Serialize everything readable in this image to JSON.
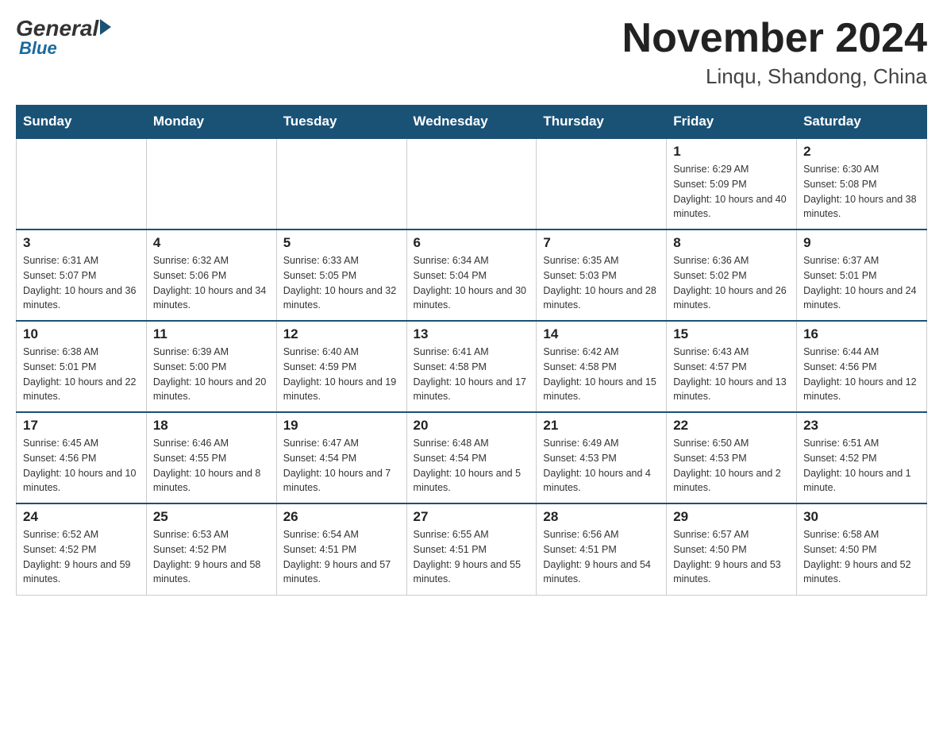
{
  "logo": {
    "general": "General",
    "blue": "Blue"
  },
  "title": {
    "month": "November 2024",
    "location": "Linqu, Shandong, China"
  },
  "weekdays": [
    "Sunday",
    "Monday",
    "Tuesday",
    "Wednesday",
    "Thursday",
    "Friday",
    "Saturday"
  ],
  "weeks": [
    [
      {
        "day": "",
        "empty": true
      },
      {
        "day": "",
        "empty": true
      },
      {
        "day": "",
        "empty": true
      },
      {
        "day": "",
        "empty": true
      },
      {
        "day": "",
        "empty": true
      },
      {
        "day": "1",
        "sunrise": "Sunrise: 6:29 AM",
        "sunset": "Sunset: 5:09 PM",
        "daylight": "Daylight: 10 hours and 40 minutes."
      },
      {
        "day": "2",
        "sunrise": "Sunrise: 6:30 AM",
        "sunset": "Sunset: 5:08 PM",
        "daylight": "Daylight: 10 hours and 38 minutes."
      }
    ],
    [
      {
        "day": "3",
        "sunrise": "Sunrise: 6:31 AM",
        "sunset": "Sunset: 5:07 PM",
        "daylight": "Daylight: 10 hours and 36 minutes."
      },
      {
        "day": "4",
        "sunrise": "Sunrise: 6:32 AM",
        "sunset": "Sunset: 5:06 PM",
        "daylight": "Daylight: 10 hours and 34 minutes."
      },
      {
        "day": "5",
        "sunrise": "Sunrise: 6:33 AM",
        "sunset": "Sunset: 5:05 PM",
        "daylight": "Daylight: 10 hours and 32 minutes."
      },
      {
        "day": "6",
        "sunrise": "Sunrise: 6:34 AM",
        "sunset": "Sunset: 5:04 PM",
        "daylight": "Daylight: 10 hours and 30 minutes."
      },
      {
        "day": "7",
        "sunrise": "Sunrise: 6:35 AM",
        "sunset": "Sunset: 5:03 PM",
        "daylight": "Daylight: 10 hours and 28 minutes."
      },
      {
        "day": "8",
        "sunrise": "Sunrise: 6:36 AM",
        "sunset": "Sunset: 5:02 PM",
        "daylight": "Daylight: 10 hours and 26 minutes."
      },
      {
        "day": "9",
        "sunrise": "Sunrise: 6:37 AM",
        "sunset": "Sunset: 5:01 PM",
        "daylight": "Daylight: 10 hours and 24 minutes."
      }
    ],
    [
      {
        "day": "10",
        "sunrise": "Sunrise: 6:38 AM",
        "sunset": "Sunset: 5:01 PM",
        "daylight": "Daylight: 10 hours and 22 minutes."
      },
      {
        "day": "11",
        "sunrise": "Sunrise: 6:39 AM",
        "sunset": "Sunset: 5:00 PM",
        "daylight": "Daylight: 10 hours and 20 minutes."
      },
      {
        "day": "12",
        "sunrise": "Sunrise: 6:40 AM",
        "sunset": "Sunset: 4:59 PM",
        "daylight": "Daylight: 10 hours and 19 minutes."
      },
      {
        "day": "13",
        "sunrise": "Sunrise: 6:41 AM",
        "sunset": "Sunset: 4:58 PM",
        "daylight": "Daylight: 10 hours and 17 minutes."
      },
      {
        "day": "14",
        "sunrise": "Sunrise: 6:42 AM",
        "sunset": "Sunset: 4:58 PM",
        "daylight": "Daylight: 10 hours and 15 minutes."
      },
      {
        "day": "15",
        "sunrise": "Sunrise: 6:43 AM",
        "sunset": "Sunset: 4:57 PM",
        "daylight": "Daylight: 10 hours and 13 minutes."
      },
      {
        "day": "16",
        "sunrise": "Sunrise: 6:44 AM",
        "sunset": "Sunset: 4:56 PM",
        "daylight": "Daylight: 10 hours and 12 minutes."
      }
    ],
    [
      {
        "day": "17",
        "sunrise": "Sunrise: 6:45 AM",
        "sunset": "Sunset: 4:56 PM",
        "daylight": "Daylight: 10 hours and 10 minutes."
      },
      {
        "day": "18",
        "sunrise": "Sunrise: 6:46 AM",
        "sunset": "Sunset: 4:55 PM",
        "daylight": "Daylight: 10 hours and 8 minutes."
      },
      {
        "day": "19",
        "sunrise": "Sunrise: 6:47 AM",
        "sunset": "Sunset: 4:54 PM",
        "daylight": "Daylight: 10 hours and 7 minutes."
      },
      {
        "day": "20",
        "sunrise": "Sunrise: 6:48 AM",
        "sunset": "Sunset: 4:54 PM",
        "daylight": "Daylight: 10 hours and 5 minutes."
      },
      {
        "day": "21",
        "sunrise": "Sunrise: 6:49 AM",
        "sunset": "Sunset: 4:53 PM",
        "daylight": "Daylight: 10 hours and 4 minutes."
      },
      {
        "day": "22",
        "sunrise": "Sunrise: 6:50 AM",
        "sunset": "Sunset: 4:53 PM",
        "daylight": "Daylight: 10 hours and 2 minutes."
      },
      {
        "day": "23",
        "sunrise": "Sunrise: 6:51 AM",
        "sunset": "Sunset: 4:52 PM",
        "daylight": "Daylight: 10 hours and 1 minute."
      }
    ],
    [
      {
        "day": "24",
        "sunrise": "Sunrise: 6:52 AM",
        "sunset": "Sunset: 4:52 PM",
        "daylight": "Daylight: 9 hours and 59 minutes."
      },
      {
        "day": "25",
        "sunrise": "Sunrise: 6:53 AM",
        "sunset": "Sunset: 4:52 PM",
        "daylight": "Daylight: 9 hours and 58 minutes."
      },
      {
        "day": "26",
        "sunrise": "Sunrise: 6:54 AM",
        "sunset": "Sunset: 4:51 PM",
        "daylight": "Daylight: 9 hours and 57 minutes."
      },
      {
        "day": "27",
        "sunrise": "Sunrise: 6:55 AM",
        "sunset": "Sunset: 4:51 PM",
        "daylight": "Daylight: 9 hours and 55 minutes."
      },
      {
        "day": "28",
        "sunrise": "Sunrise: 6:56 AM",
        "sunset": "Sunset: 4:51 PM",
        "daylight": "Daylight: 9 hours and 54 minutes."
      },
      {
        "day": "29",
        "sunrise": "Sunrise: 6:57 AM",
        "sunset": "Sunset: 4:50 PM",
        "daylight": "Daylight: 9 hours and 53 minutes."
      },
      {
        "day": "30",
        "sunrise": "Sunrise: 6:58 AM",
        "sunset": "Sunset: 4:50 PM",
        "daylight": "Daylight: 9 hours and 52 minutes."
      }
    ]
  ]
}
